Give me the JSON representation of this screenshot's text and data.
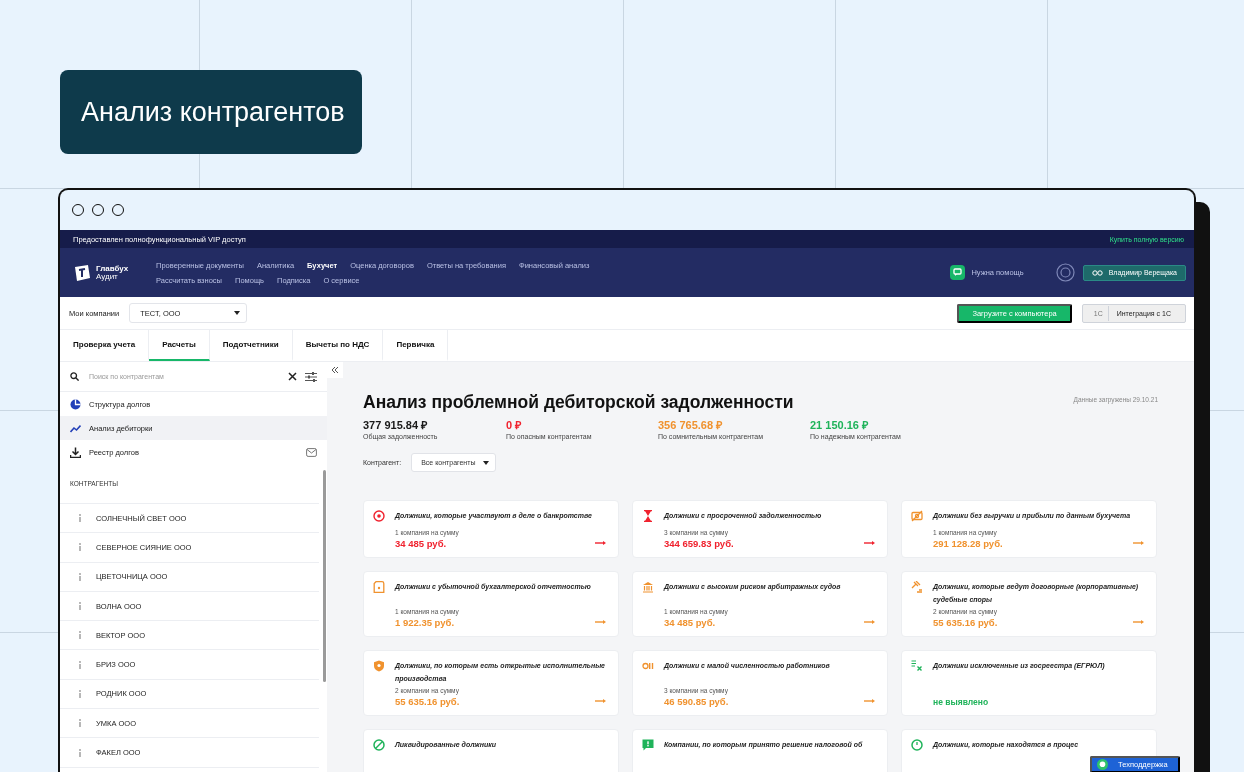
{
  "promo_label": "Анализ контрагентов",
  "app": {
    "vip_bar": {
      "notice": "Предоставлен полнофункциональный VIP доступ",
      "buy_link": "Купить полную версию"
    },
    "logo": {
      "title": "Главбух",
      "subtitle": "Аудит"
    },
    "nav": [
      [
        {
          "label": "Проверенные документы",
          "selected": false
        },
        {
          "label": "Аналитика",
          "selected": false
        },
        {
          "label": "Бухучет",
          "selected": true
        },
        {
          "label": "Оценка договоров",
          "selected": false
        },
        {
          "label": "Ответы на требования",
          "selected": false
        },
        {
          "label": "Финансовый анализ",
          "selected": false
        }
      ],
      [
        {
          "label": "Рассчитать взносы",
          "selected": false
        },
        {
          "label": "Помощь",
          "selected": false
        },
        {
          "label": "Подписка",
          "selected": false
        },
        {
          "label": "О сервисе",
          "selected": false
        }
      ]
    ],
    "help": "Нужна помощь",
    "user": "Владимир Верещака",
    "company_label": "Мои компании",
    "company": "ТЕСТ, ООО",
    "upload_button": "Загрузите с компьютера",
    "integration": {
      "badge": "1С",
      "label": "Интеграция с 1С"
    },
    "tabs": [
      {
        "label": "Проверка учета",
        "selected": false
      },
      {
        "label": "Расчеты",
        "selected": true
      },
      {
        "label": "Подотчетники",
        "selected": false
      },
      {
        "label": "Вычеты по НДС",
        "selected": false
      },
      {
        "label": "Первичка",
        "selected": false
      }
    ],
    "sidebar": {
      "search": {
        "placeholder": "Поиск по контрагентам"
      },
      "menu": [
        {
          "kind": "pie",
          "label": "Структура долгов",
          "selected": false
        },
        {
          "kind": "trend",
          "label": "Анализ дебиторки",
          "selected": true
        },
        {
          "kind": "download",
          "label": "Реестр долгов",
          "selected": false,
          "mail": true
        }
      ],
      "section": "КОНТРАГЕНТЫ",
      "counterparties": [
        "СОЛНЕЧНЫЙ СВЕТ ООО",
        "СЕВЕРНОЕ СИЯНИЕ ООО",
        "ЦВЕТОЧНИЦА ООО",
        "ВОЛНА ООО",
        "ВЕКТОР ООО",
        "БРИЗ ООО",
        "РОДНИК ООО",
        "УМКА ООО",
        "ФАКЕЛ ООО"
      ]
    },
    "main": {
      "title": "Анализ проблемной дебиторской задолженности",
      "loaded": "Данные загружены 29.10.21",
      "stats": [
        {
          "value": "377 915.84 ₽",
          "label": "Общая задолженность",
          "color": "#1a1a1a"
        },
        {
          "value": "0 ₽",
          "label": "По опасным контрагентам",
          "color": "#f0222e"
        },
        {
          "value": "356 765.68 ₽",
          "label": "По сомнительным контрагентам",
          "color": "#f0922e"
        },
        {
          "value": "21 150.16 ₽",
          "label": "По надежным контрагентам",
          "color": "#1fb35a"
        }
      ],
      "filter_label": "Контрагент:",
      "filter_value": "Все контрагенты",
      "cards": [
        {
          "kind": "target",
          "color": "#f0222e",
          "title": "Должники, которые участвуют в деле о банкротстве",
          "count": "1 компания на сумму",
          "amount": "34 485 руб."
        },
        {
          "kind": "hourglass",
          "color": "#f0222e",
          "title": "Должники с просроченной задолженностью",
          "count": "3 компании на сумму",
          "amount": "344 659.83 руб."
        },
        {
          "kind": "money",
          "color": "#f0922e",
          "title": "Должники без выручки и прибыли по данным бухучета",
          "count": "1 компания на сумму",
          "amount": "291 128.28 руб."
        },
        {
          "kind": "document",
          "color": "#f0922e",
          "title": "Должники с убыточной бухгалтерской отчетностью",
          "count": "1 компания на сумму",
          "amount": "1 922.35 руб."
        },
        {
          "kind": "bank",
          "color": "#f0922e",
          "title": "Должники с высоким риском арбитражных судов",
          "count": "1 компания на сумму",
          "amount": "34 485 руб."
        },
        {
          "kind": "gavel",
          "color": "#f0922e",
          "title": "Должники, которые ведут договорные (корпоративные) судебные споры",
          "count": "2 компании на сумму",
          "amount": "55 635.16 руб."
        },
        {
          "kind": "pin",
          "color": "#f0922e",
          "title": "Должники, по которым есть открытые исполнительные производства",
          "count": "2 компании на сумму",
          "amount": "55 635.16 руб."
        },
        {
          "kind": "people",
          "color": "#f0922e",
          "title": "Должники с малой численностью работников",
          "count": "3 компании на сумму",
          "amount": "46 590.85 руб."
        },
        {
          "kind": "registry",
          "color": "#1fb35a",
          "title": "Должники исключенные из госреестра (ЕГРЮЛ)",
          "status": "не выявлено"
        },
        {
          "kind": "ban",
          "color": "#1fb35a",
          "title": "Ликвидированные должники"
        },
        {
          "kind": "message",
          "color": "#1fb35a",
          "title": "Компании, по которым принято решение налоговой об"
        },
        {
          "kind": "clock",
          "color": "#1fb35a",
          "title": "Должники, которые находятся в процес"
        }
      ]
    },
    "support_button": "Техподдержка"
  }
}
